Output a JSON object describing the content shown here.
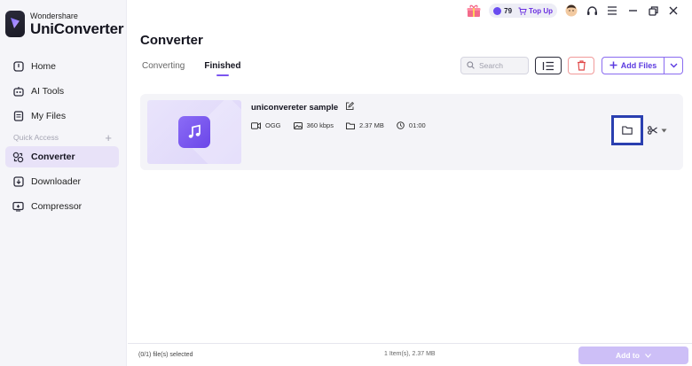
{
  "brand": {
    "company": "Wondershare",
    "product": "UniConverter"
  },
  "sidebar": {
    "items": [
      {
        "label": "Home",
        "icon": "home-icon"
      },
      {
        "label": "AI Tools",
        "icon": "robot-icon"
      },
      {
        "label": "My Files",
        "icon": "files-icon"
      }
    ],
    "quick_access_label": "Quick Access",
    "quick_items": [
      {
        "label": "Converter",
        "icon": "converter-icon",
        "active": true
      },
      {
        "label": "Downloader",
        "icon": "download-icon"
      },
      {
        "label": "Compressor",
        "icon": "compress-icon"
      }
    ]
  },
  "topbar": {
    "coins": "79",
    "topup_label": "Top Up"
  },
  "header": {
    "title": "Converter",
    "tabs": [
      {
        "label": "Converting"
      },
      {
        "label": "Finished",
        "active": true
      }
    ],
    "search_placeholder": "Search",
    "add_files_label": "Add Files"
  },
  "file": {
    "name": "uniconvereter sample",
    "format": "OGG",
    "bitrate": "360 kbps",
    "size": "2.37 MB",
    "duration": "01:00"
  },
  "footer": {
    "selected": "(0/1) file(s) selected",
    "items_info": "1 Item(s), 2.37 MB",
    "add_to_label": "Add to"
  },
  "colors": {
    "accent": "#7b55f0",
    "highlight_border": "#2a3fb0",
    "delete": "#f19a9a"
  }
}
